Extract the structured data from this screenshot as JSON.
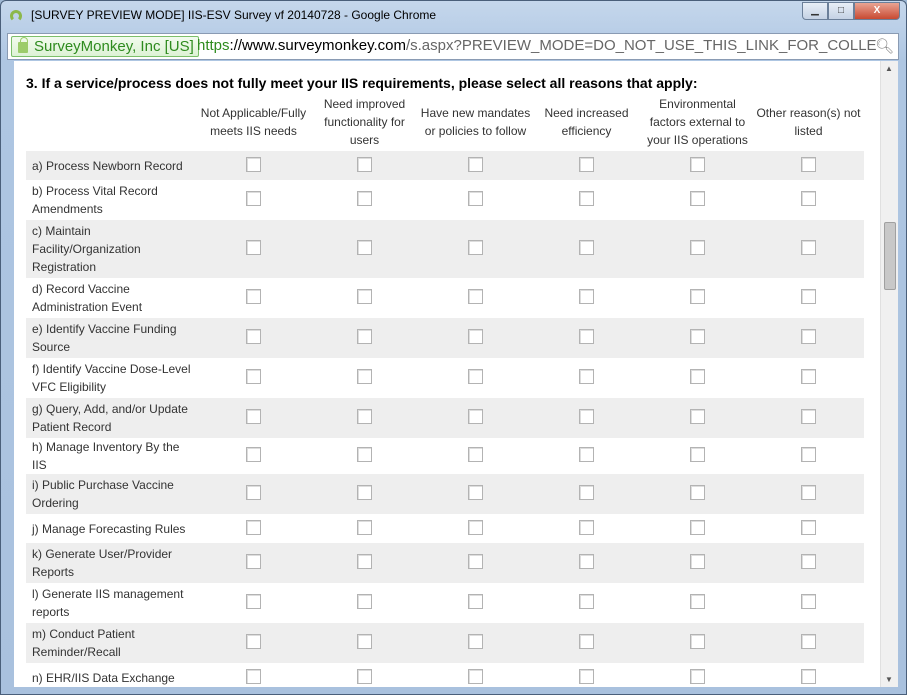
{
  "window": {
    "title": "[SURVEY PREVIEW MODE] IIS-ESV Survey vf 20140728 - Google Chrome",
    "min": "▁",
    "max": "□",
    "close": "X"
  },
  "address_bar": {
    "security_label": "SurveyMonkey, Inc [US]",
    "url_scheme": "https",
    "url_host": "://www.surveymonkey.com",
    "url_path": "/s.aspx?PREVIEW_MODE=DO_NOT_USE_THIS_LINK_FOR_COLLEC"
  },
  "question": "3. If a service/process does not fully meet your IIS requirements, please select all reasons that apply:",
  "columns": [
    "Not Applicable/Fully meets IIS needs",
    "Need improved functionality for users",
    "Have new mandates or policies to follow",
    "Need increased efficiency",
    "Environmental factors external to your IIS operations",
    "Other reason(s) not listed"
  ],
  "rows": [
    "a) Process Newborn Record",
    "b) Process Vital Record Amendments",
    "c) Maintain Facility/Organization Registration",
    "d) Record Vaccine Administration Event",
    "e) Identify Vaccine Funding Source",
    "f) Identify Vaccine Dose-Level VFC Eligibility",
    "g) Query, Add, and/or Update Patient Record",
    "h) Manage Inventory By the IIS",
    "i) Public Purchase Vaccine Ordering",
    "j) Manage Forecasting Rules",
    "k) Generate User/Provider Reports",
    "l) Generate IIS management reports",
    "m) Conduct Patient Reminder/Recall",
    "n) EHR/IIS Data Exchange"
  ]
}
